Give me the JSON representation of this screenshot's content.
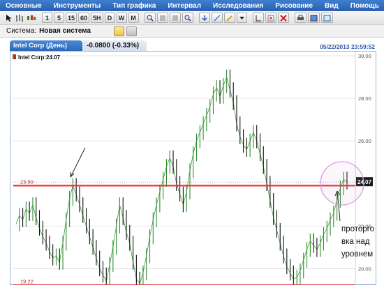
{
  "menu": {
    "items": [
      "Основные",
      "Инструменты",
      "Тип графика",
      "Интервал",
      "Исследования",
      "Рисование",
      "Вид",
      "Помощь"
    ]
  },
  "toolbar": {
    "intervals": [
      "1",
      "5",
      "15",
      "60",
      "5H",
      "D",
      "W",
      "M"
    ],
    "icons": [
      "cursor-icon",
      "bar-chart-icon",
      "candles-icon",
      "zoom-in-icon",
      "zoom-out-icon",
      "zoom-fit-icon",
      "zoom-reset-icon",
      "download-icon",
      "line-draw-icon",
      "pencil-icon",
      "dropdown-arrow-icon",
      "crosshair-icon",
      "delete-drawing-icon",
      "delete-all-icon",
      "print-icon",
      "save-image-icon",
      "fullscreen-icon"
    ]
  },
  "system": {
    "label": "Система:",
    "value": "Новая система"
  },
  "tab": {
    "title": "Intel Corp (День)",
    "change": "-0.0800 (-0.33%)",
    "timestamp": "05/22/2013 23:59:52"
  },
  "chart_data": {
    "type": "line",
    "title": "Intel Corp:24.07",
    "last_price": "24.07",
    "ylim": [
      19.2,
      30.0
    ],
    "y_ticks": [
      "30.00",
      "28.00",
      "26.00",
      "22.00",
      "20.00"
    ],
    "levels": [
      {
        "value": 23.9,
        "label": "23.90",
        "color": "#ee3333"
      },
      {
        "value": 19.22,
        "label": "19.22",
        "color": "#ee3333"
      }
    ],
    "series": [
      {
        "values": [
          22.1,
          22.5,
          22.3,
          22.8,
          22.6,
          23.0,
          22.4,
          21.9,
          21.5,
          21.2,
          20.8,
          20.5,
          20.6,
          20.3,
          21.2,
          22.3,
          23.3,
          23.9,
          23.5,
          23.0,
          22.5,
          22.0,
          21.5,
          21.0,
          20.5,
          20.0,
          19.7,
          19.4,
          20.2,
          21.0,
          22.0,
          23.0,
          22.4,
          21.7,
          21.2,
          20.3,
          19.5,
          19.3,
          19.8,
          20.6,
          21.5,
          22.3,
          23.0,
          23.6,
          24.2,
          24.8,
          25.2,
          24.8,
          24.0,
          23.5,
          23.0,
          23.6,
          24.6,
          25.4,
          26.0,
          26.4,
          26.8,
          27.2,
          27.6,
          28.2,
          28.5,
          28.1,
          28.6,
          29.0,
          28.4,
          27.8,
          26.8,
          26.2,
          25.8,
          25.6,
          26.0,
          26.4,
          26.0,
          25.4,
          24.8,
          24.0,
          23.2,
          22.4,
          21.8,
          21.2,
          20.6,
          20.1,
          19.8,
          19.5,
          19.6,
          19.9,
          20.4,
          20.9,
          21.3,
          21.1,
          20.9,
          21.2,
          21.6,
          21.9,
          22.3,
          22.6,
          23.2,
          23.8,
          24.2,
          24.07
        ]
      }
    ],
    "annotations": [
      "проторго",
      "вка над",
      "уровнем"
    ]
  }
}
